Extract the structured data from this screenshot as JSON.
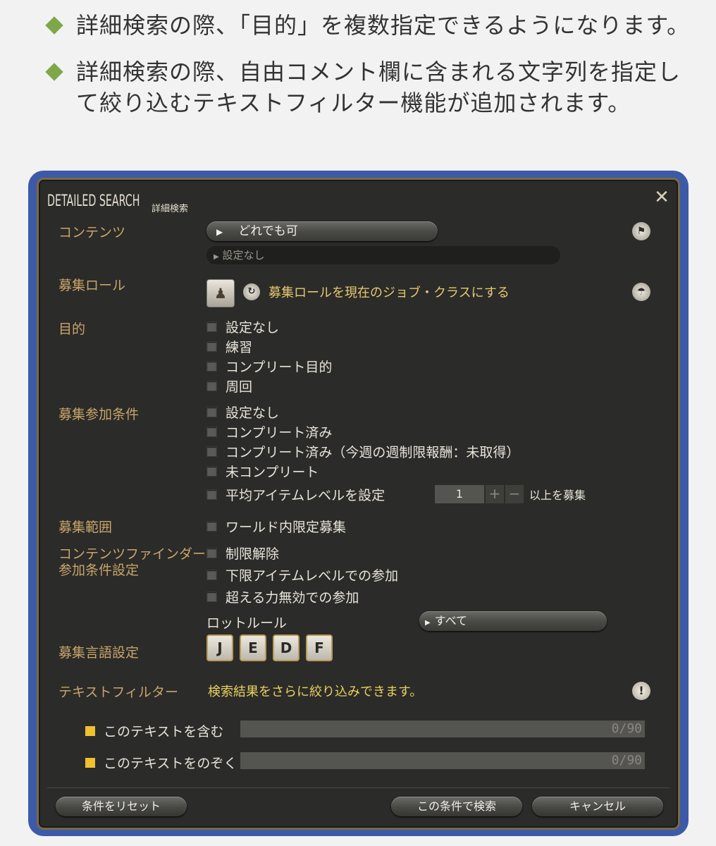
{
  "bullets": [
    "詳細検索の際、「目的」を複数指定できるようになります。",
    "詳細検索の際、自由コメント欄に含まれる文字列を指定して絞り込むテキストフィルター機能が追加されます。"
  ],
  "window": {
    "title": "DETAILED SEARCH",
    "subtitle": "詳細検索"
  },
  "content": {
    "label": "コンテンツ",
    "dropdown_value": "どれでも可",
    "sub_dropdown_value": "設定なし"
  },
  "role": {
    "label": "募集ロール",
    "set_current_label": "募集ロールを現在のジョブ・クラスにする"
  },
  "purpose": {
    "label": "目的",
    "options": [
      "設定なし",
      "練習",
      "コンプリート目的",
      "周回"
    ]
  },
  "conditions": {
    "label": "募集参加条件",
    "options": [
      "設定なし",
      "コンプリート済み",
      "コンプリート済み（今週の週制限報酬：未取得）",
      "未コンプリート",
      "平均アイテムレベルを設定"
    ],
    "item_level_value": "1",
    "plus": "+",
    "minus": "−",
    "item_level_suffix": "以上を募集"
  },
  "scope": {
    "label": "募集範囲",
    "option": "ワールド内限定募集"
  },
  "finder": {
    "label_line1": "コンテンツファインダー",
    "label_line2": "参加条件設定",
    "options": [
      "制限解除",
      "下限アイテムレベルでの参加",
      "超える力無効での参加"
    ],
    "loot_label": "ロットルール",
    "loot_value": "すべて"
  },
  "language": {
    "label": "募集言語設定",
    "buttons": [
      "J",
      "E",
      "D",
      "F"
    ]
  },
  "text_filter": {
    "label": "テキストフィルター",
    "hint": "検索結果をさらに絞り込みできます。",
    "include_label": "このテキストを含む",
    "include_count": "0/90",
    "exclude_label": "このテキストをのぞく",
    "exclude_count": "0/90"
  },
  "buttons": {
    "reset": "条件をリセット",
    "search": "この条件で検索",
    "cancel": "キャンセル"
  },
  "colors": {
    "accent_green": "#7ca84a",
    "frame_blue": "#3d5aa8",
    "label_gold": "#c8a56a",
    "hint_yellow": "#e8d060"
  }
}
